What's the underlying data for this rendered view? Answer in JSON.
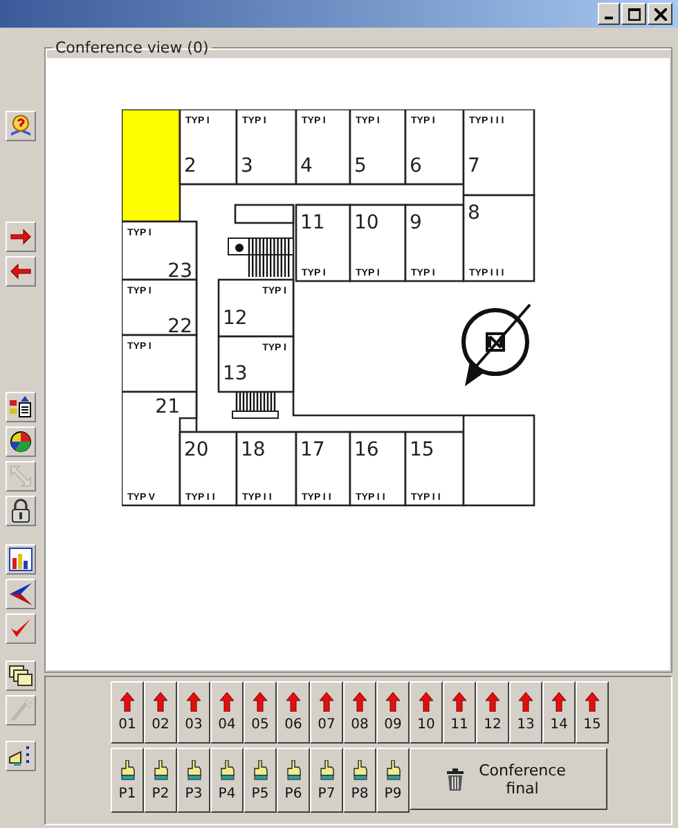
{
  "toolbar": [
    {
      "buttons": [
        {
          "disabled": false
        }
      ]
    },
    {
      "buttons": [
        {
          "disabled": false
        },
        {
          "disabled": false
        }
      ]
    },
    {
      "buttons": [
        {
          "disabled": false
        },
        {
          "disabled": false
        },
        {
          "disabled": true
        },
        {
          "disabled": false
        }
      ]
    },
    {
      "buttons": [
        {
          "disabled": false
        },
        {
          "disabled": false
        },
        {
          "disabled": false
        }
      ]
    },
    {
      "buttons": [
        {
          "disabled": false
        },
        {
          "disabled": true
        }
      ]
    },
    {
      "buttons": [
        {
          "disabled": false
        }
      ]
    }
  ],
  "conference_view": {
    "title": "Conference view (0)",
    "rooms": [
      {
        "selected": true
      },
      {
        "number": "2",
        "type": "TYP I",
        "selected": false
      },
      {
        "number": "3",
        "type": "TYP I",
        "selected": false
      },
      {
        "number": "4",
        "type": "TYP I",
        "selected": false
      },
      {
        "number": "5",
        "type": "TYP I",
        "selected": false
      },
      {
        "number": "6",
        "type": "TYP I",
        "selected": false
      },
      {
        "number": "7",
        "type": "TYP I I I",
        "selected": false
      },
      {
        "number": "23",
        "type": "TYP I",
        "selected": false
      },
      {
        "number": "11",
        "type": "TYP I",
        "selected": false
      },
      {
        "number": "10",
        "type": "TYP I",
        "selected": false
      },
      {
        "number": "9",
        "type": "TYP I",
        "selected": false
      },
      {
        "number": "8",
        "type": "TYP I I I",
        "selected": false
      },
      {
        "number": "22",
        "type": "TYP I",
        "selected": false
      },
      {
        "number": "12",
        "type": "TYP I",
        "selected": false
      },
      {
        "type": "TYP I",
        "selected": false
      },
      {
        "number": "13",
        "type": "TYP I",
        "selected": false
      },
      {
        "number": "21",
        "type": "TYP V",
        "selected": false
      },
      {
        "number": "20",
        "type": "TYP I I",
        "selected": false
      },
      {
        "number": "18",
        "type": "TYP I I",
        "selected": false
      },
      {
        "number": "17",
        "type": "TYP I I",
        "selected": false
      },
      {
        "number": "16",
        "type": "TYP I I",
        "selected": false
      },
      {
        "number": "15",
        "type": "TYP I I",
        "selected": false
      },
      {
        "selected": false
      }
    ]
  },
  "seat_buttons": [
    "01",
    "02",
    "03",
    "04",
    "05",
    "06",
    "07",
    "08",
    "09",
    "10",
    "11",
    "12",
    "13",
    "14",
    "15"
  ],
  "presets": [
    "P1",
    "P2",
    "P3",
    "P4",
    "P5",
    "P6",
    "P7",
    "P8",
    "P9"
  ],
  "final_button": "Conference final"
}
